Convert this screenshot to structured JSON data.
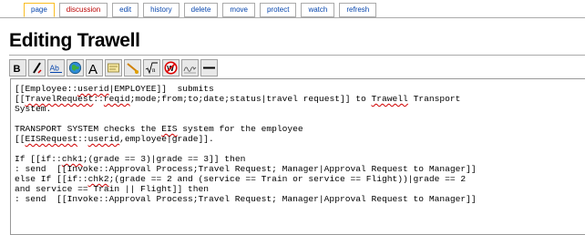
{
  "tabs": [
    {
      "label": "page",
      "state": "selected"
    },
    {
      "label": "discussion",
      "state": "new"
    },
    {
      "label": "edit",
      "state": "normal"
    },
    {
      "label": "history",
      "state": "normal"
    },
    {
      "label": "delete",
      "state": "normal"
    },
    {
      "label": "move",
      "state": "normal"
    },
    {
      "label": "protect",
      "state": "normal"
    },
    {
      "label": "watch",
      "state": "normal"
    },
    {
      "label": "refresh",
      "state": "normal"
    }
  ],
  "page_title": "Editing Trawell",
  "toolbar": [
    {
      "name": "bold-button",
      "icon": "bold-icon",
      "glyph": "B"
    },
    {
      "name": "italic-button",
      "icon": "italic-icon",
      "glyph": "/"
    },
    {
      "name": "internal-link-button",
      "icon": "internal-link-icon",
      "glyph": "Ab"
    },
    {
      "name": "external-link-button",
      "icon": "globe-icon",
      "glyph": ""
    },
    {
      "name": "headline-button",
      "icon": "headline-icon",
      "glyph": "A"
    },
    {
      "name": "embedded-image-button",
      "icon": "image-icon",
      "glyph": ""
    },
    {
      "name": "media-link-button",
      "icon": "media-icon",
      "glyph": ""
    },
    {
      "name": "math-formula-button",
      "icon": "math-icon",
      "glyph": "√n"
    },
    {
      "name": "no-wiki-button",
      "icon": "no-wiki-icon",
      "glyph": "W"
    },
    {
      "name": "signature-button",
      "icon": "signature-icon",
      "glyph": ""
    },
    {
      "name": "horizontal-line-button",
      "icon": "horizontal-line-icon",
      "glyph": ""
    }
  ],
  "editor": {
    "lines": [
      "[[Employee::userid|EMPLOYEE]]  submits",
      "[[TravelRequest::reqid;mode;from;to;date;status|travel request]] to Trawell Transport",
      "System.",
      "",
      "TRANSPORT SYSTEM checks the EIS system for the employee",
      "[[EISRequest::userid,employee|grade]].",
      "",
      "If [[if::chk1;(grade == 3)|grade == 3]] then",
      ": send  [[Invoke::Approval Process;Travel Request; Manager|Approval Request to Manager]]",
      "else If [[if::chk2;(grade == 2 and (service == Train or service == Flight))|grade == 2",
      "and service == Train || Flight]] then",
      ": send  [[Invoke::Approval Process;Travel Request; Manager|Approval Request to Manager]]"
    ],
    "misspelled": [
      "userid",
      "TravelRequest",
      "reqid",
      "Trawell",
      "EIS",
      "EISRequest",
      "chk1",
      "chk2"
    ]
  }
}
